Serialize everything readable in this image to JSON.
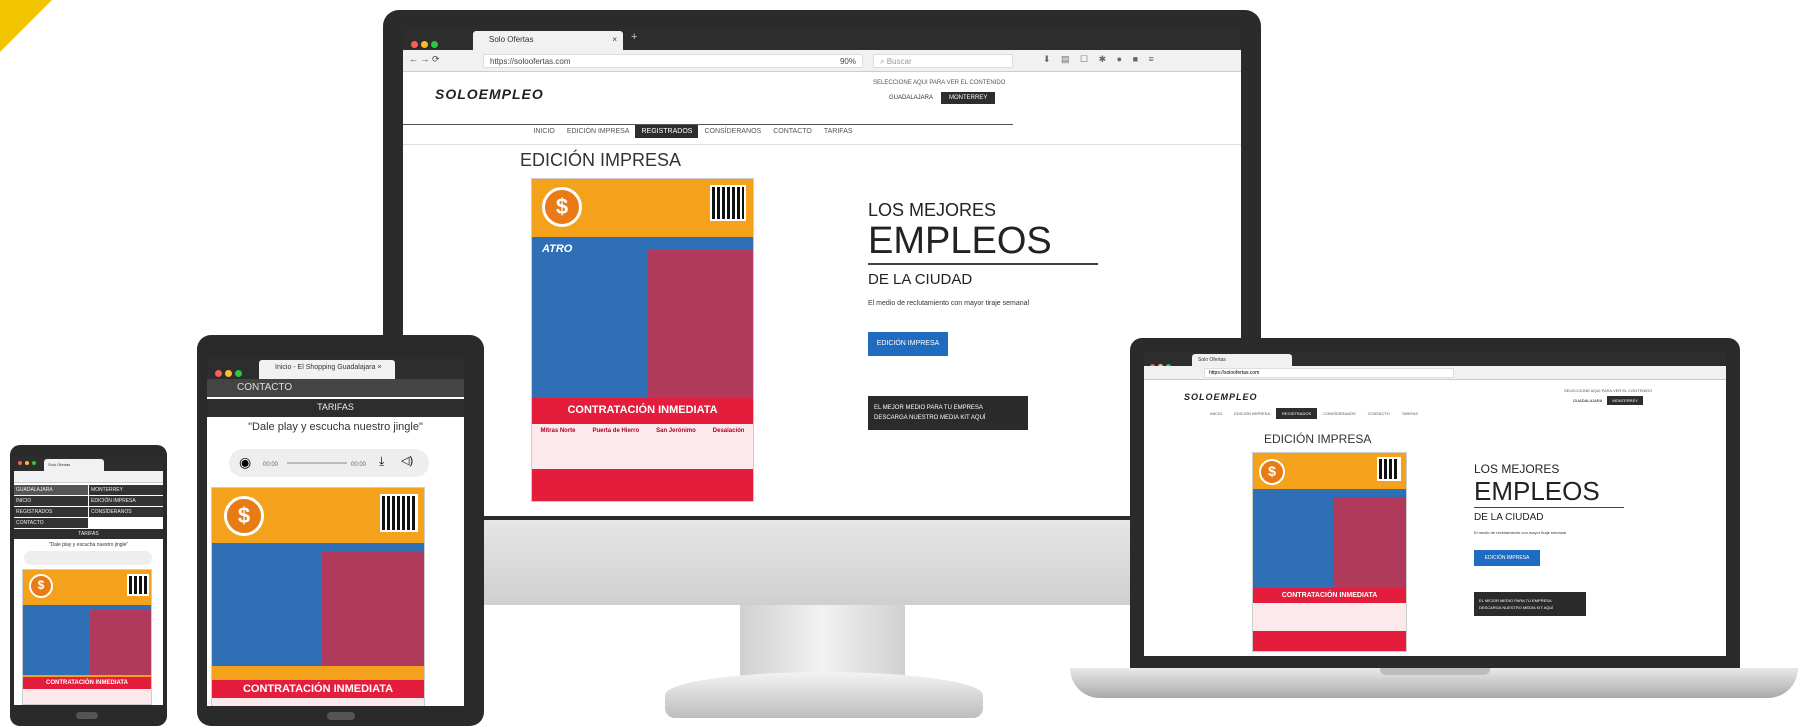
{
  "browser": {
    "tab_title": "Solo Ofertas",
    "url": "https://soloofertas.com",
    "zoom": "90%",
    "search_placeholder": "Buscar",
    "tablet_tab_title": "Inicio - El Shopping Guadalajara"
  },
  "site": {
    "logo": "SOLOEMPLEO",
    "region_prompt": "SELECCIONE AQUI PARA VER EL CONTENIDO",
    "regions": [
      "GUADALAJARA",
      "MONTERREY"
    ],
    "nav": [
      "INICIO",
      "EDICIÓN IMPRESA",
      "REGISTRADOS",
      "CONSÍDERANOS",
      "CONTACTO",
      "TARIFAS"
    ],
    "active_nav": "REGISTRADOS"
  },
  "main": {
    "heading": "EDICIÓN IMPRESA",
    "hero_line1": "LOS MEJORES",
    "hero_line2": "EMPLEOS",
    "hero_line3": "DE LA CIUDAD",
    "subtitle": "El medio de reclutamiento con mayor tiraje semanal",
    "cta_button": "EDICIÓN IMPRESA",
    "media_kit_line1": "EL MEJOR MEDIO PARA TU EMPRESA",
    "media_kit_line2": "DESCARGA NUESTRO MEDIA KIT AQUÍ"
  },
  "flyer": {
    "banner": "CONTRATACIÓN INMEDIATA",
    "brand": "ATRO",
    "columns": [
      "Mitras Norte",
      "Puerta de Hierro",
      "San Jerónimo",
      "Desalación"
    ]
  },
  "mobile": {
    "contacto": "CONTACTO",
    "tarifas": "TARIFAS",
    "jingle": "\"Dale play y escucha nuestro jingle\"",
    "time_current": "00:00",
    "time_total": "00:00"
  },
  "colors": {
    "accent_yellow": "#f5c400",
    "blue": "#1e6bbf",
    "red": "#e51d3d"
  }
}
